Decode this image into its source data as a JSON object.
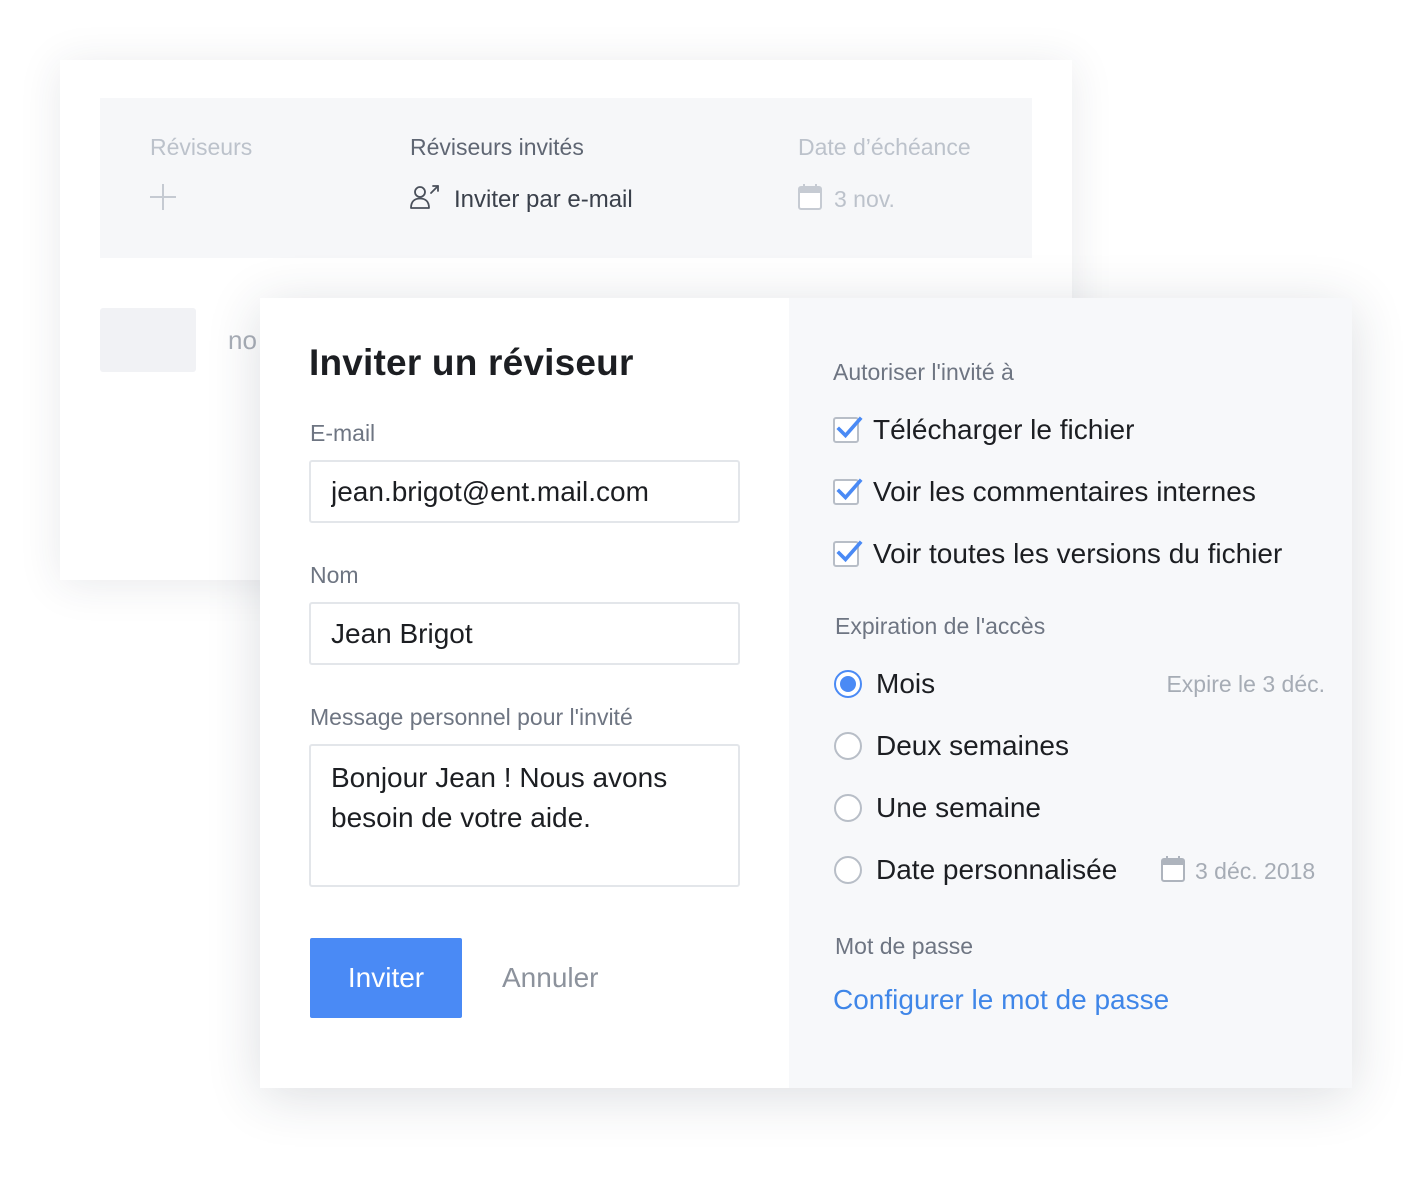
{
  "background_card": {
    "columns": {
      "reviewers_label": "Réviseurs",
      "invited_label": "Réviseurs invités",
      "due_date_label": "Date d’échéance"
    },
    "invite_email_link": "Inviter par e-mail",
    "due_date_value": "3 nov.",
    "partial_text": "no"
  },
  "modal": {
    "title": "Inviter un réviseur",
    "email": {
      "label": "E-mail",
      "value": "jean.brigot@ent.mail.com"
    },
    "name": {
      "label": "Nom",
      "value": "Jean Brigot"
    },
    "message": {
      "label": "Message personnel pour l'invité",
      "value": "Bonjour Jean ! Nous avons besoin de votre aide."
    },
    "invite_button": "Inviter",
    "cancel_button": "Annuler",
    "permissions": {
      "label": "Autoriser l'invité à",
      "items": [
        {
          "label": "Télécharger le fichier",
          "checked": true
        },
        {
          "label": "Voir les commentaires internes",
          "checked": true
        },
        {
          "label": "Voir toutes les versions du fichier",
          "checked": true
        }
      ]
    },
    "expiration": {
      "label": "Expiration de l'accès",
      "options": [
        {
          "label": "Mois",
          "selected": true
        },
        {
          "label": "Deux semaines",
          "selected": false
        },
        {
          "label": "Une semaine",
          "selected": false
        },
        {
          "label": "Date personnalisée",
          "selected": false
        }
      ],
      "expire_note": "Expire le 3 déc.",
      "custom_date_value": "3 déc. 2018"
    },
    "password": {
      "label": "Mot de passe",
      "link": "Configurer le mot de passe"
    }
  },
  "colors": {
    "accent": "#4a8af5",
    "link": "#3f86e8",
    "panel_bg": "#f7f8fa",
    "muted_text": "#a6acb5"
  },
  "icons": [
    "plus-icon",
    "invite-user-icon",
    "calendar-icon",
    "checkmark-icon"
  ]
}
